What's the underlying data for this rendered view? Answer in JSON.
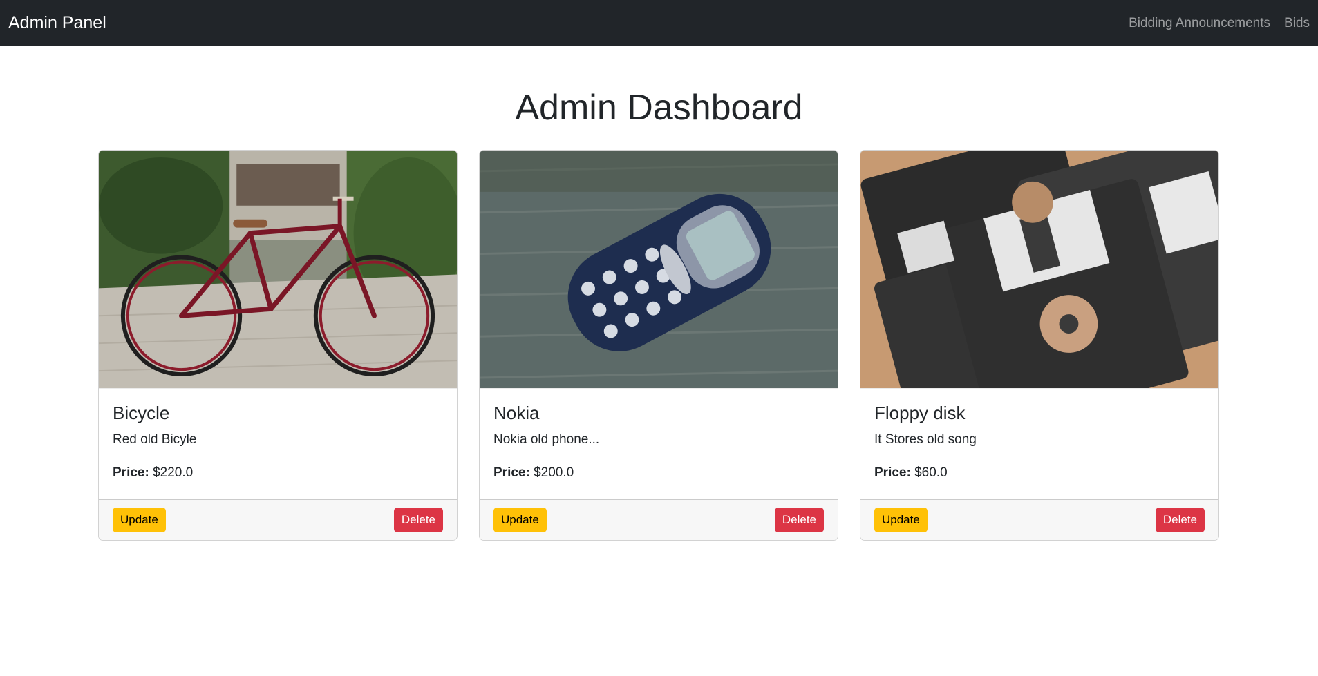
{
  "navbar": {
    "brand": "Admin Panel",
    "links": [
      "Bidding Announcements",
      "Bids"
    ]
  },
  "page": {
    "title": "Admin Dashboard"
  },
  "items": [
    {
      "title": "Bicycle",
      "description": "Red old Bicyle",
      "price_label": "Price:",
      "price": "$220.0",
      "update_label": "Update",
      "delete_label": "Delete"
    },
    {
      "title": "Nokia",
      "description": "Nokia old phone...",
      "price_label": "Price:",
      "price": "$200.0",
      "update_label": "Update",
      "delete_label": "Delete"
    },
    {
      "title": "Floppy disk",
      "description": "It Stores old song",
      "price_label": "Price:",
      "price": "$60.0",
      "update_label": "Update",
      "delete_label": "Delete"
    }
  ],
  "colors": {
    "navbar_bg": "#212529",
    "update_button": "#ffc107",
    "delete_button": "#dc3545"
  }
}
